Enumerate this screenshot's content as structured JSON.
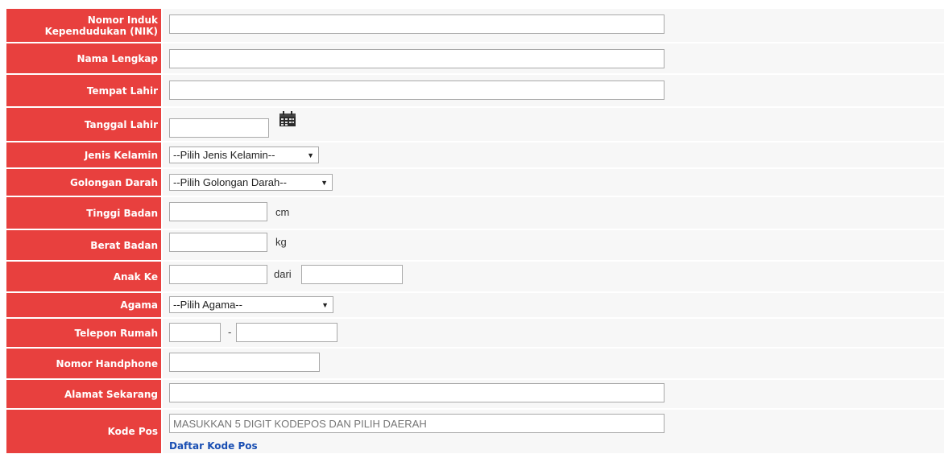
{
  "form": {
    "nik": {
      "label": "Nomor Induk Kependudukan (NIK)",
      "value": ""
    },
    "nama": {
      "label": "Nama Lengkap",
      "value": ""
    },
    "tempat_lahir": {
      "label": "Tempat Lahir",
      "value": ""
    },
    "tanggal_lahir": {
      "label": "Tanggal Lahir",
      "value": "",
      "icon": "calendar-icon"
    },
    "jenis_kelamin": {
      "label": "Jenis Kelamin",
      "selected": "--Pilih Jenis Kelamin--"
    },
    "golongan_darah": {
      "label": "Golongan Darah",
      "selected": "--Pilih Golongan Darah--"
    },
    "tinggi_badan": {
      "label": "Tinggi Badan",
      "value": "",
      "unit": "cm"
    },
    "berat_badan": {
      "label": "Berat Badan",
      "value": "",
      "unit": "kg"
    },
    "anak_ke": {
      "label": "Anak Ke",
      "value": "",
      "separator": "dari",
      "value_dari": ""
    },
    "agama": {
      "label": "Agama",
      "selected": "--Pilih Agama--"
    },
    "telepon_rumah": {
      "label": "Telepon Rumah",
      "area": "",
      "separator": "-",
      "number": ""
    },
    "handphone": {
      "label": "Nomor Handphone",
      "value": ""
    },
    "alamat": {
      "label": "Alamat Sekarang",
      "value": ""
    },
    "kode_pos": {
      "label": "Kode Pos",
      "placeholder": "MASUKKAN 5 DIGIT KODEPOS DAN PILIH DAERAH",
      "link": "Daftar Kode Pos"
    }
  },
  "colors": {
    "label_bg": "#e8403e",
    "link": "#1a4fb3"
  }
}
